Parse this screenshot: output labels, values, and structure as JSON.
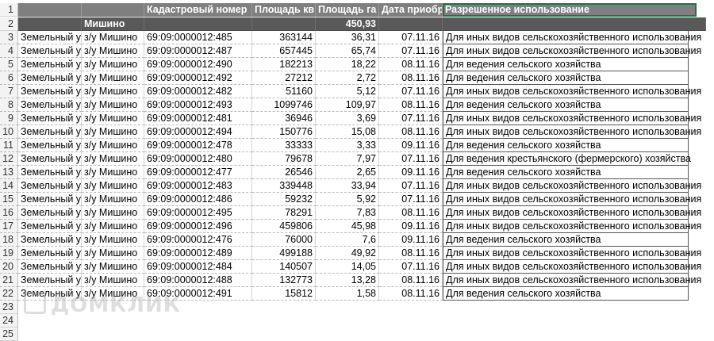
{
  "header": {
    "rownum": "1",
    "cols": [
      "",
      "",
      "Кадастровый номер",
      "Площадь кв",
      "Площадь га",
      "Дата приобр",
      "Разрешенное использование"
    ]
  },
  "group_row": {
    "rownum": "2",
    "label": "Мишино",
    "total_ha": "450,93"
  },
  "rows": [
    {
      "n": "3",
      "type": "Земельный у",
      "name": "з/у Мишино",
      "cad": "69:09:0000012:485",
      "sqm": "363144",
      "ha": "36,31",
      "date": "07.11.16",
      "use": "Для иных видов сельскохозяйственного использования"
    },
    {
      "n": "4",
      "type": "Земельный у",
      "name": "з/у Мишино",
      "cad": "69:09:0000012:487",
      "sqm": "657445",
      "ha": "65,74",
      "date": "07.11.16",
      "use": "Для иных видов сельскохозяйственного использования"
    },
    {
      "n": "5",
      "type": "Земельный у",
      "name": "з/у Мишино",
      "cad": "69:09:0000012:490",
      "sqm": "182213",
      "ha": "18,22",
      "date": "08.11.16",
      "use": "Для ведения сельского хозяйства"
    },
    {
      "n": "6",
      "type": "Земельный у",
      "name": "з/у Мишино",
      "cad": "69:09:0000012:492",
      "sqm": "27212",
      "ha": "2,72",
      "date": "08.11.16",
      "use": "Для ведения сельского хозяйства"
    },
    {
      "n": "7",
      "type": "Земельный у",
      "name": "з/у Мишино",
      "cad": "69:09:0000012:482",
      "sqm": "51160",
      "ha": "5,12",
      "date": "07.11.16",
      "use": "Для иных видов сельскохозяйственного использования"
    },
    {
      "n": "8",
      "type": "Земельный у",
      "name": "з/у Мишино",
      "cad": "69:09:0000012:493",
      "sqm": "1099746",
      "ha": "109,97",
      "date": "08.11.16",
      "use": "Для ведения сельского хозяйства"
    },
    {
      "n": "9",
      "type": "Земельный у",
      "name": "з/у Мишино",
      "cad": "69:09:0000012:481",
      "sqm": "36946",
      "ha": "3,69",
      "date": "07.11.16",
      "use": "Для иных видов сельскохозяйственного использования"
    },
    {
      "n": "10",
      "type": "Земельный у",
      "name": "з/у Мишино",
      "cad": "69:09:0000012:494",
      "sqm": "150776",
      "ha": "15,08",
      "date": "08.11.16",
      "use": "Для иных видов сельскохозяйственного использования"
    },
    {
      "n": "11",
      "type": "Земельный у",
      "name": "з/у Мишино",
      "cad": "69:09:0000012:478",
      "sqm": "33333",
      "ha": "3,33",
      "date": "09.11.16",
      "use": "Для ведения сельского хозяйства"
    },
    {
      "n": "12",
      "type": "Земельный у",
      "name": "з/у Мишино",
      "cad": "69:09:0000012:480",
      "sqm": "79678",
      "ha": "7,97",
      "date": "07.11.16",
      "use": "Для ведения крестьянского (фермерского) хозяйства"
    },
    {
      "n": "13",
      "type": "Земельный у",
      "name": "з/у Мишино",
      "cad": "69:09:0000012:477",
      "sqm": "26546",
      "ha": "2,65",
      "date": "09.11.16",
      "use": "Для ведения сельского хозяйства"
    },
    {
      "n": "14",
      "type": "Земельный у",
      "name": "з/у Мишино",
      "cad": "69:09:0000012:483",
      "sqm": "339448",
      "ha": "33,94",
      "date": "07.11.16",
      "use": "Для иных видов сельскохозяйственного использования"
    },
    {
      "n": "15",
      "type": "Земельный у",
      "name": "з/у Мишино",
      "cad": "69:09:0000012:486",
      "sqm": "59232",
      "ha": "5,92",
      "date": "07.11.16",
      "use": "Для иных видов сельскохозяйственного использования"
    },
    {
      "n": "16",
      "type": "Земельный у",
      "name": "з/у Мишино",
      "cad": "69:09:0000012:495",
      "sqm": "78291",
      "ha": "7,83",
      "date": "08.11.16",
      "use": "Для иных видов сельскохозяйственного использования"
    },
    {
      "n": "17",
      "type": "Земельный у",
      "name": "з/у Мишино",
      "cad": "69:09:0000012:496",
      "sqm": "459806",
      "ha": "45,98",
      "date": "09.11.16",
      "use": "Для иных видов сельскохозяйственного использования"
    },
    {
      "n": "18",
      "type": "Земельный у",
      "name": "з/у Мишино",
      "cad": "69:09:0000012:476",
      "sqm": "76000",
      "ha": "7,6",
      "date": "09.11.16",
      "use": "Для ведения сельского хозяйства"
    },
    {
      "n": "19",
      "type": "Земельный у",
      "name": "з/у Мишино",
      "cad": "69:09:0000012:489",
      "sqm": "499188",
      "ha": "49,92",
      "date": "08.11.16",
      "use": "Для иных видов сельскохозяйственного использования"
    },
    {
      "n": "20",
      "type": "Земельный у",
      "name": "з/у Мишино",
      "cad": "69:09:0000012:484",
      "sqm": "140507",
      "ha": "14,05",
      "date": "07.11.16",
      "use": "Для иных видов сельскохозяйственного использования"
    },
    {
      "n": "21",
      "type": "Земельный у",
      "name": "з/у Мишино",
      "cad": "69:09:0000012:488",
      "sqm": "132773",
      "ha": "13,28",
      "date": "08.11.16",
      "use": "Для иных видов сельскохозяйственного использования"
    },
    {
      "n": "22",
      "type": "Земельный у",
      "name": "з/у Мишино",
      "cad": "69:09:0000012:491",
      "sqm": "15812",
      "ha": "1,58",
      "date": "08.11.16",
      "use": "Для ведения сельского хозяйства"
    }
  ],
  "empty_rows": [
    "23",
    "24",
    "25"
  ],
  "watermark": "ДОМКЛИК"
}
